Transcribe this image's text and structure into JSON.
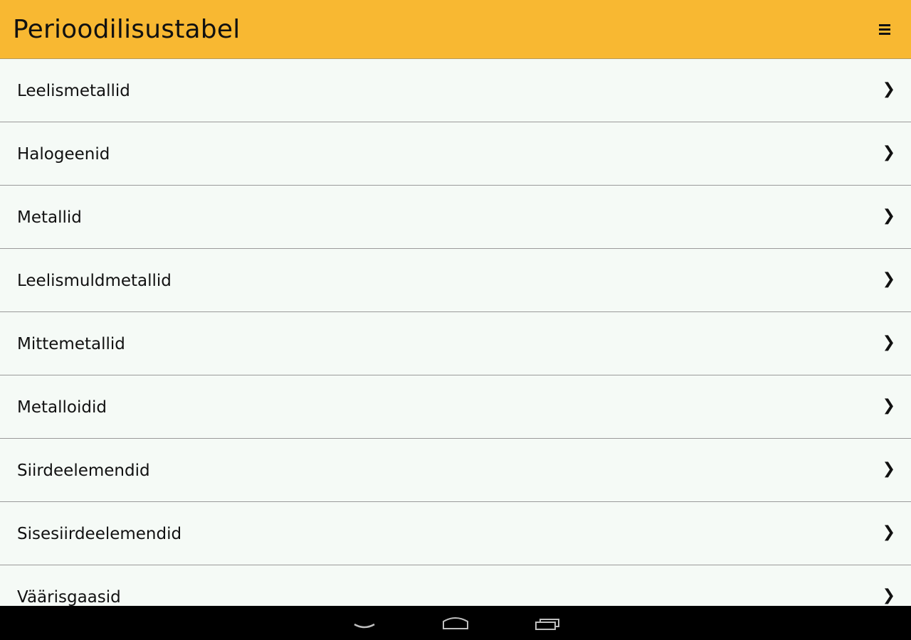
{
  "header": {
    "title": "Perioodilisustabel",
    "menu_icon": "hamburger-menu-icon"
  },
  "categories": [
    {
      "label": "Leelismetallid",
      "icon": "chevron-right-icon",
      "chevron": "❯"
    },
    {
      "label": "Halogeenid",
      "icon": "chevron-right-icon",
      "chevron": "❯"
    },
    {
      "label": "Metallid",
      "icon": "chevron-right-icon",
      "chevron": "❯"
    },
    {
      "label": "Leelismuldmetallid",
      "icon": "chevron-right-icon",
      "chevron": "❯"
    },
    {
      "label": "Mittemetallid",
      "icon": "chevron-right-icon",
      "chevron": "❯"
    },
    {
      "label": "Metalloidid",
      "icon": "chevron-right-icon",
      "chevron": "❯"
    },
    {
      "label": "Siirdeelemendid",
      "icon": "chevron-right-icon",
      "chevron": "❯"
    },
    {
      "label": "Sisesiirdeelemendid",
      "icon": "chevron-right-icon",
      "chevron": "❯"
    },
    {
      "label": "Väärisgaasid",
      "icon": "chevron-right-icon",
      "chevron": "❯"
    }
  ],
  "navigation_bar": {
    "buttons": [
      "back-icon",
      "home-icon",
      "recent-apps-icon"
    ]
  },
  "colors": {
    "header_background": "#f8b832",
    "list_background": "#f5faf6",
    "divider": "#9a9a9a",
    "nav_background": "#000000"
  }
}
